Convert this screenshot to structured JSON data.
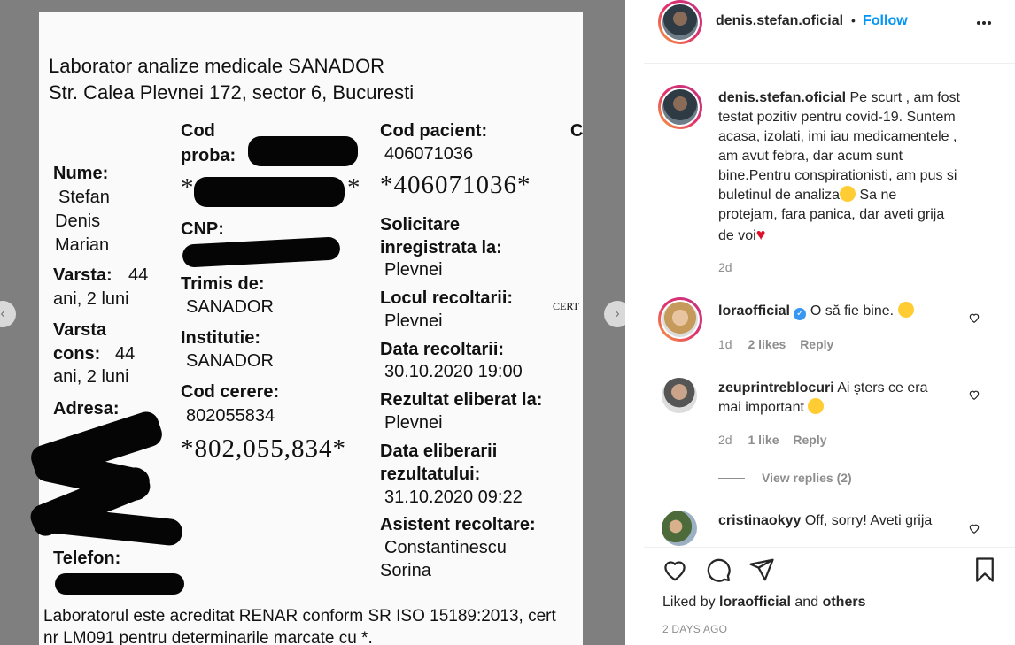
{
  "document": {
    "lab_name": "Laborator analize medicale SANADOR",
    "lab_address": "Str. Calea Plevnei 172, sector 6, Bucuresti",
    "labels": {
      "cod_proba_1": "Cod",
      "cod_proba_2": "proba:",
      "cod_pacient": "Cod pacient:",
      "col_c": "C",
      "nume": "Nume:",
      "cnp": "CNP:",
      "solicitare_1": "Solicitare",
      "solicitare_2": "inregistrata la:",
      "varsta": "Varsta:",
      "trimis": "Trimis de:",
      "locul": "Locul recoltarii:",
      "varsta_cons_1": "Varsta",
      "varsta_cons_2": "cons:",
      "institutie": "Institutie:",
      "data_recoltarii": "Data recoltarii:",
      "cod_cerere": "Cod cerere:",
      "rezultat": "Rezultat eliberat la:",
      "adresa": "Adresa:",
      "data_eliberarii_1": "Data eliberarii",
      "data_eliberarii_2": "rezultatului:",
      "asistent": "Asistent recoltare:",
      "telefon": "Telefon:"
    },
    "values": {
      "cod_pacient": "406071036",
      "cod_pacient_barcode": "*406071036*",
      "nume_1": "Stefan",
      "nume_2": "Denis",
      "nume_3": "Marian",
      "varsta_value": "44",
      "varsta_luni": "ani, 2 luni",
      "varsta_cons_value": "44",
      "varsta_cons_luni": "ani, 2 luni",
      "solicitare": "Plevnei",
      "trimis": "SANADOR",
      "locul": "Plevnei",
      "cert": "CERT",
      "institutie": "SANADOR",
      "data_recoltarii": "30.10.2020 19:00",
      "cod_cerere": "802055834",
      "cod_cerere_barcode": "*802,055,834*",
      "rezultat": "Plevnei",
      "data_eliberarii": "31.10.2020 09:22",
      "asistent_1": "Constantinescu",
      "asistent_2": "Sorina"
    },
    "footer_1": "Laboratorul este acreditat RENAR conform SR ISO 15189:2013, cert",
    "footer_2": "nr LM091 pentru determinarile marcate cu *."
  },
  "post": {
    "username": "denis.stefan.oficial",
    "separator": "•",
    "follow_label": "Follow",
    "caption_lines": [
      "Pe scurt , am fost",
      "testat pozitiv pentru covid-19. Suntem",
      "acasa, izolati, imi iau medicamentele ,",
      "am avut febra, dar acum sunt",
      "bine.Pentru conspirationisti, am pus si",
      "buletinul de analiza",
      "Sa ne",
      "protejam, fara panica, dar aveti grija",
      "de voi"
    ],
    "caption_age": "2d",
    "comments": [
      {
        "username": "loraofficial",
        "text": "O să fie bine.",
        "age": "1d",
        "likes": "2 likes",
        "reply": "Reply"
      },
      {
        "username": "zeuprintreblocuri",
        "text_1": "Ai șters ce era",
        "text_2": "mai important",
        "age": "2d",
        "likes": "1 like",
        "reply": "Reply",
        "view_replies": "View replies (2)"
      },
      {
        "username": "cristinaokyy",
        "text": "Off, sorry! Aveti grija"
      }
    ],
    "liked_by_prefix": "Liked by",
    "liked_by_user": "loraofficial",
    "liked_by_and": "and",
    "liked_by_others": "others",
    "timestamp": "2 DAYS AGO"
  },
  "colors": {
    "accent": "#0095f6",
    "verified": "#3897f0",
    "heart": "#e0102a"
  }
}
